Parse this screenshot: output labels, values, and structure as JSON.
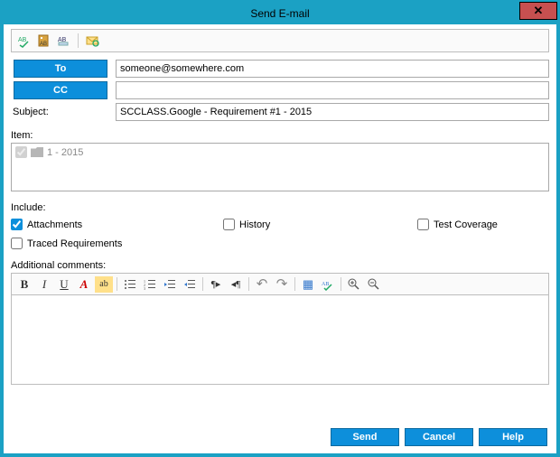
{
  "window": {
    "title": "Send E-mail",
    "close": "✕"
  },
  "toolbar": {
    "spellcheck": "ABC",
    "addressbook": "AB",
    "formatting": "AB",
    "customize": "⚙"
  },
  "fields": {
    "to_label": "To",
    "to_value": "someone@somewhere.com",
    "cc_label": "CC",
    "cc_value": "",
    "subject_label": "Subject:",
    "subject_value": "SCCLASS.Google - Requirement #1 - 2015"
  },
  "item": {
    "label": "Item:",
    "rows": [
      {
        "checked": true,
        "text": "1 - 2015"
      }
    ]
  },
  "include": {
    "label": "Include:",
    "attachments": {
      "label": "Attachments",
      "checked": true
    },
    "history": {
      "label": "History",
      "checked": false
    },
    "testcoverage": {
      "label": "Test Coverage",
      "checked": false
    },
    "traced": {
      "label": "Traced Requirements",
      "checked": false
    }
  },
  "comments": {
    "label": "Additional comments:"
  },
  "editor": {
    "bold": "B",
    "italic": "I",
    "underline": "U",
    "font": "A",
    "highlight": "ab",
    "bullets": "≡",
    "numbers": "≣",
    "outdent": "⇤",
    "indent": "⇥",
    "ltr": "¶▸",
    "rtl": "◂¶",
    "undo": "↶",
    "redo": "↷",
    "table": "▦",
    "spell": "✓",
    "zoomin": "⊕",
    "zoomout": "⊖"
  },
  "buttons": {
    "send": "Send",
    "cancel": "Cancel",
    "help": "Help"
  }
}
